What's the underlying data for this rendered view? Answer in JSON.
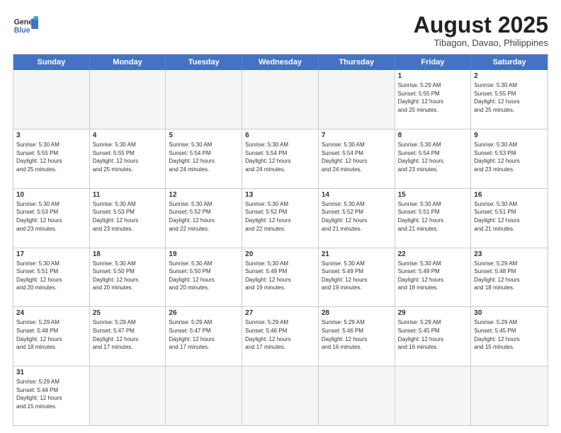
{
  "header": {
    "logo_general": "General",
    "logo_blue": "Blue",
    "month_title": "August 2025",
    "location": "Tibagon, Davao, Philippines"
  },
  "weekdays": [
    "Sunday",
    "Monday",
    "Tuesday",
    "Wednesday",
    "Thursday",
    "Friday",
    "Saturday"
  ],
  "rows": [
    {
      "cells": [
        {
          "day": "",
          "info": ""
        },
        {
          "day": "",
          "info": ""
        },
        {
          "day": "",
          "info": ""
        },
        {
          "day": "",
          "info": ""
        },
        {
          "day": "",
          "info": ""
        },
        {
          "day": "1",
          "info": "Sunrise: 5:29 AM\nSunset: 5:55 PM\nDaylight: 12 hours\nand 25 minutes."
        },
        {
          "day": "2",
          "info": "Sunrise: 5:30 AM\nSunset: 5:55 PM\nDaylight: 12 hours\nand 25 minutes."
        }
      ]
    },
    {
      "cells": [
        {
          "day": "3",
          "info": "Sunrise: 5:30 AM\nSunset: 5:55 PM\nDaylight: 12 hours\nand 25 minutes."
        },
        {
          "day": "4",
          "info": "Sunrise: 5:30 AM\nSunset: 5:55 PM\nDaylight: 12 hours\nand 25 minutes."
        },
        {
          "day": "5",
          "info": "Sunrise: 5:30 AM\nSunset: 5:54 PM\nDaylight: 12 hours\nand 24 minutes."
        },
        {
          "day": "6",
          "info": "Sunrise: 5:30 AM\nSunset: 5:54 PM\nDaylight: 12 hours\nand 24 minutes."
        },
        {
          "day": "7",
          "info": "Sunrise: 5:30 AM\nSunset: 5:54 PM\nDaylight: 12 hours\nand 24 minutes."
        },
        {
          "day": "8",
          "info": "Sunrise: 5:30 AM\nSunset: 5:54 PM\nDaylight: 12 hours\nand 23 minutes."
        },
        {
          "day": "9",
          "info": "Sunrise: 5:30 AM\nSunset: 5:53 PM\nDaylight: 12 hours\nand 23 minutes."
        }
      ]
    },
    {
      "cells": [
        {
          "day": "10",
          "info": "Sunrise: 5:30 AM\nSunset: 5:53 PM\nDaylight: 12 hours\nand 23 minutes."
        },
        {
          "day": "11",
          "info": "Sunrise: 5:30 AM\nSunset: 5:53 PM\nDaylight: 12 hours\nand 23 minutes."
        },
        {
          "day": "12",
          "info": "Sunrise: 5:30 AM\nSunset: 5:52 PM\nDaylight: 12 hours\nand 22 minutes."
        },
        {
          "day": "13",
          "info": "Sunrise: 5:30 AM\nSunset: 5:52 PM\nDaylight: 12 hours\nand 22 minutes."
        },
        {
          "day": "14",
          "info": "Sunrise: 5:30 AM\nSunset: 5:52 PM\nDaylight: 12 hours\nand 21 minutes."
        },
        {
          "day": "15",
          "info": "Sunrise: 5:30 AM\nSunset: 5:51 PM\nDaylight: 12 hours\nand 21 minutes."
        },
        {
          "day": "16",
          "info": "Sunrise: 5:30 AM\nSunset: 5:51 PM\nDaylight: 12 hours\nand 21 minutes."
        }
      ]
    },
    {
      "cells": [
        {
          "day": "17",
          "info": "Sunrise: 5:30 AM\nSunset: 5:51 PM\nDaylight: 12 hours\nand 20 minutes."
        },
        {
          "day": "18",
          "info": "Sunrise: 5:30 AM\nSunset: 5:50 PM\nDaylight: 12 hours\nand 20 minutes."
        },
        {
          "day": "19",
          "info": "Sunrise: 5:30 AM\nSunset: 5:50 PM\nDaylight: 12 hours\nand 20 minutes."
        },
        {
          "day": "20",
          "info": "Sunrise: 5:30 AM\nSunset: 5:49 PM\nDaylight: 12 hours\nand 19 minutes."
        },
        {
          "day": "21",
          "info": "Sunrise: 5:30 AM\nSunset: 5:49 PM\nDaylight: 12 hours\nand 19 minutes."
        },
        {
          "day": "22",
          "info": "Sunrise: 5:30 AM\nSunset: 5:49 PM\nDaylight: 12 hours\nand 18 minutes."
        },
        {
          "day": "23",
          "info": "Sunrise: 5:29 AM\nSunset: 5:48 PM\nDaylight: 12 hours\nand 18 minutes."
        }
      ]
    },
    {
      "cells": [
        {
          "day": "24",
          "info": "Sunrise: 5:29 AM\nSunset: 5:48 PM\nDaylight: 12 hours\nand 18 minutes."
        },
        {
          "day": "25",
          "info": "Sunrise: 5:29 AM\nSunset: 5:47 PM\nDaylight: 12 hours\nand 17 minutes."
        },
        {
          "day": "26",
          "info": "Sunrise: 5:29 AM\nSunset: 5:47 PM\nDaylight: 12 hours\nand 17 minutes."
        },
        {
          "day": "27",
          "info": "Sunrise: 5:29 AM\nSunset: 5:46 PM\nDaylight: 12 hours\nand 17 minutes."
        },
        {
          "day": "28",
          "info": "Sunrise: 5:29 AM\nSunset: 5:46 PM\nDaylight: 12 hours\nand 16 minutes."
        },
        {
          "day": "29",
          "info": "Sunrise: 5:29 AM\nSunset: 5:45 PM\nDaylight: 12 hours\nand 16 minutes."
        },
        {
          "day": "30",
          "info": "Sunrise: 5:29 AM\nSunset: 5:45 PM\nDaylight: 12 hours\nand 15 minutes."
        }
      ]
    },
    {
      "cells": [
        {
          "day": "31",
          "info": "Sunrise: 5:29 AM\nSunset: 5:44 PM\nDaylight: 12 hours\nand 15 minutes."
        },
        {
          "day": "",
          "info": ""
        },
        {
          "day": "",
          "info": ""
        },
        {
          "day": "",
          "info": ""
        },
        {
          "day": "",
          "info": ""
        },
        {
          "day": "",
          "info": ""
        },
        {
          "day": "",
          "info": ""
        }
      ]
    }
  ]
}
